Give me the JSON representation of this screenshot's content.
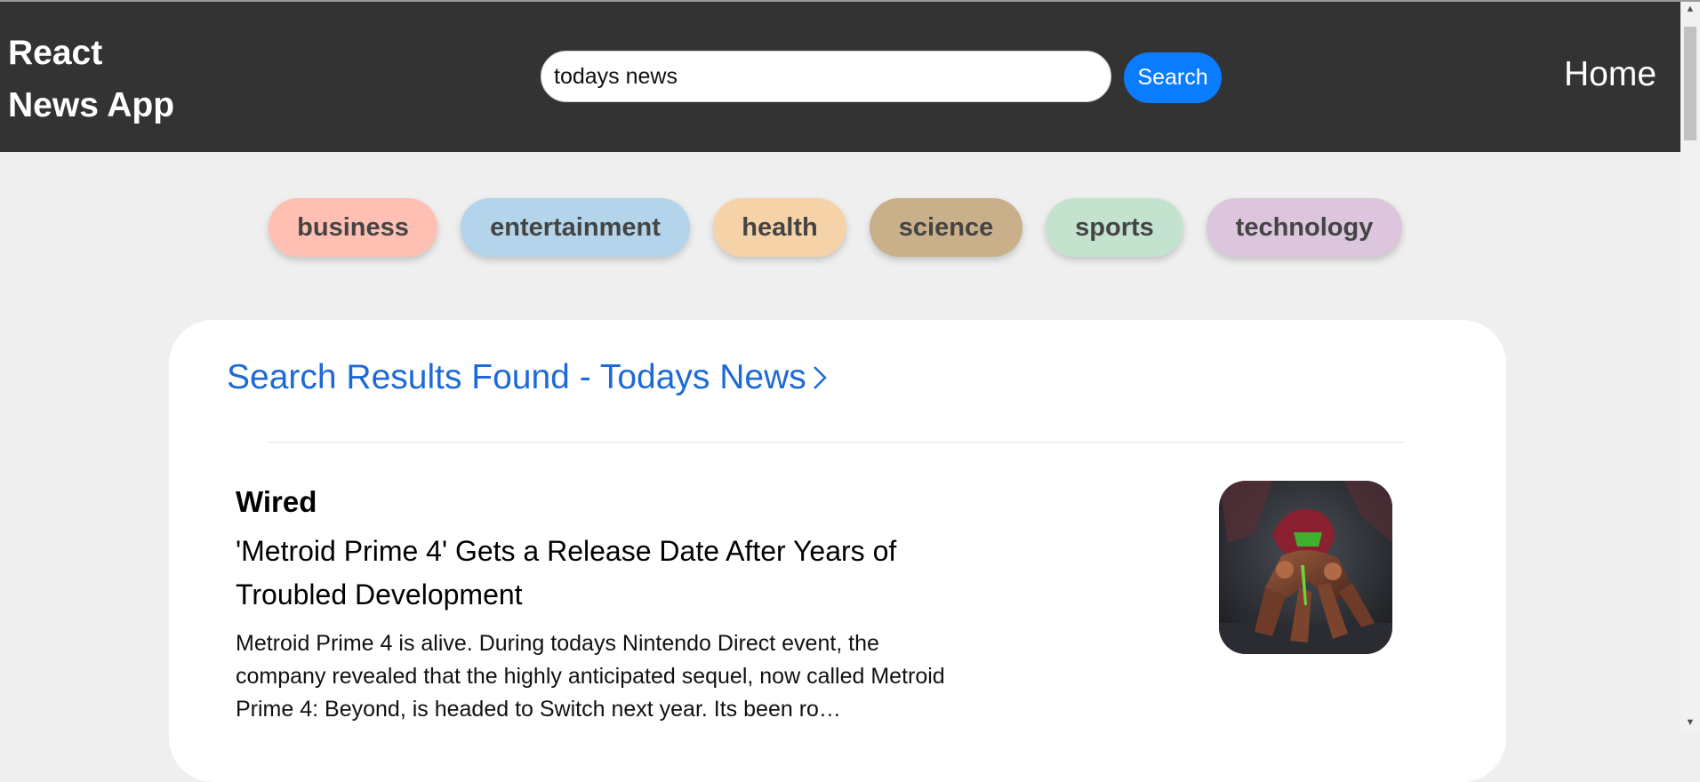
{
  "header": {
    "brand_line1": "React",
    "brand_line2": "News App",
    "search_value": "todays news",
    "search_button": "Search",
    "home_link": "Home"
  },
  "categories": [
    {
      "label": "business",
      "color": "#ffc0b3"
    },
    {
      "label": "entertainment",
      "color": "#b3d4ea"
    },
    {
      "label": "health",
      "color": "#f6d2a8"
    },
    {
      "label": "science",
      "color": "#c9af8a"
    },
    {
      "label": "sports",
      "color": "#c4e3cf"
    },
    {
      "label": "technology",
      "color": "#dcc6dd"
    }
  ],
  "results": {
    "title": "Search Results Found - Todays News",
    "article": {
      "source": "Wired",
      "headline": "'Metroid Prime 4' Gets a Release Date After Years of Troubled Development",
      "description": "Metroid Prime 4 is alive. During todays Nintendo Direct event, the company revealed that the highly anticipated sequel, now called Metroid Prime 4: Beyond, is headed to Switch next year. Its been ro…"
    }
  },
  "colors": {
    "navbar": "#333333",
    "search_button": "#0a7cff",
    "title_link": "#1d6ad7"
  }
}
